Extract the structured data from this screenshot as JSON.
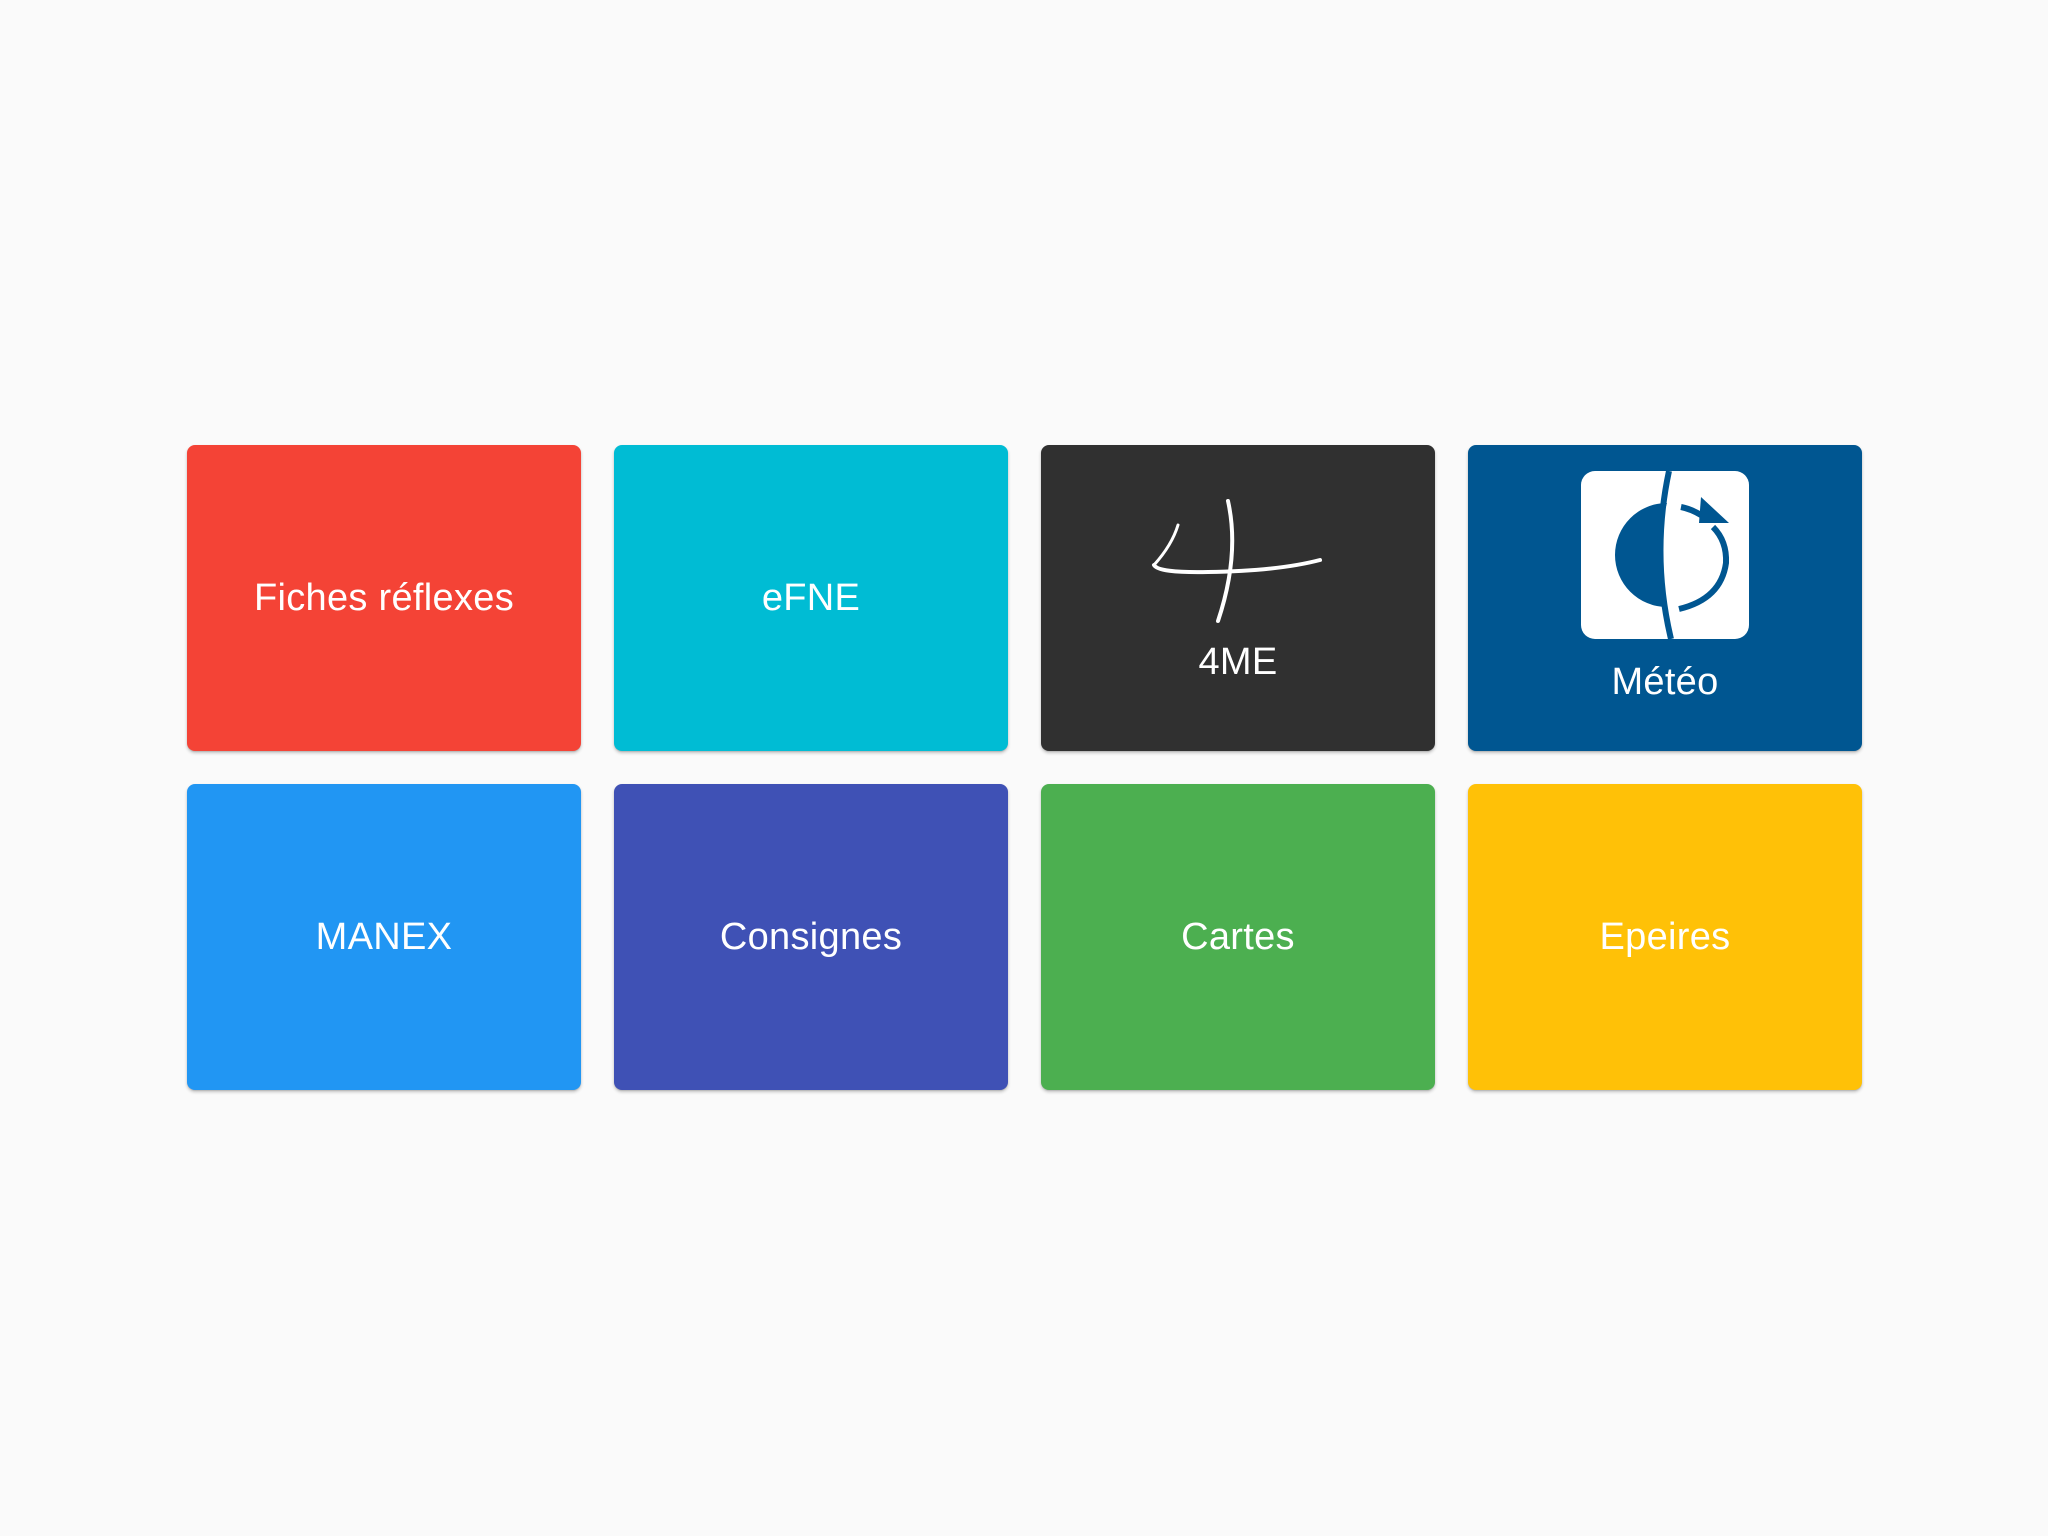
{
  "tiles": [
    {
      "label": "Fiches réflexes",
      "color": "#f44336"
    },
    {
      "label": "eFNE",
      "color": "#00bcd4"
    },
    {
      "label": "4ME",
      "color": "#303030",
      "icon": "4me-logo-icon"
    },
    {
      "label": "Météo",
      "color": "#005691",
      "icon": "meteo-logo-icon"
    },
    {
      "label": "MANEX",
      "color": "#2196f3"
    },
    {
      "label": "Consignes",
      "color": "#3f51b5"
    },
    {
      "label": "Cartes",
      "color": "#4caf50"
    },
    {
      "label": "Epeires",
      "color": "#ffc107"
    }
  ]
}
